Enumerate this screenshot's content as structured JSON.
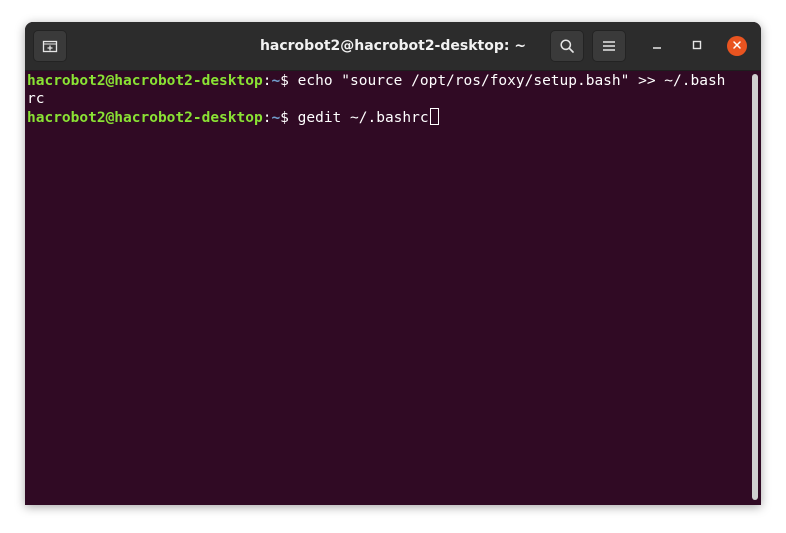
{
  "window": {
    "title": "hacrobot2@hacrobot2-desktop: ~"
  },
  "titlebar": {
    "new_tab_icon": "new-tab-icon",
    "search_icon": "search-icon",
    "menu_icon": "hamburger-menu-icon",
    "minimize_icon": "minimize-icon",
    "maximize_icon": "maximize-icon",
    "close_icon": "close-icon"
  },
  "terminal": {
    "lines": [
      {
        "user_host": "hacrobot2@hacrobot2-desktop",
        "colon": ":",
        "path": "~",
        "prompt": "$ ",
        "command": "echo \"source /opt/ros/foxy/setup.bash\" >> ~/.bash"
      },
      {
        "text": "rc"
      },
      {
        "user_host": "hacrobot2@hacrobot2-desktop",
        "colon": ":",
        "path": "~",
        "prompt": "$ ",
        "command": "gedit ~/.bashrc"
      }
    ]
  },
  "colors": {
    "terminal_bg": "#300a24",
    "titlebar_bg": "#2c2c2c",
    "prompt_user": "#8ae234",
    "prompt_path": "#729fcf",
    "close_button": "#e95420"
  }
}
